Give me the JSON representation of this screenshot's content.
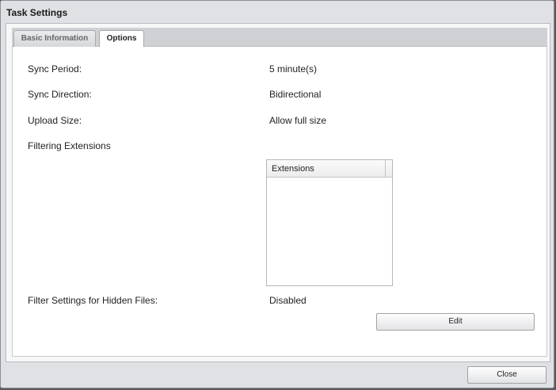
{
  "dialog": {
    "title": "Task Settings",
    "close_label": "Close"
  },
  "tabs": [
    {
      "label": "Basic Information",
      "active": false
    },
    {
      "label": "Options",
      "active": true
    }
  ],
  "options": {
    "sync_period": {
      "label": "Sync Period:",
      "value": "5 minute(s)"
    },
    "sync_direction": {
      "label": "Sync Direction:",
      "value": "Bidirectional"
    },
    "upload_size": {
      "label": "Upload Size:",
      "value": "Allow full size"
    },
    "filtering_extensions": {
      "label": "Filtering Extensions",
      "column_header": "Extensions",
      "rows": []
    },
    "hidden_files": {
      "label": "Filter Settings for Hidden Files:",
      "value": "Disabled"
    },
    "edit_label": "Edit"
  }
}
